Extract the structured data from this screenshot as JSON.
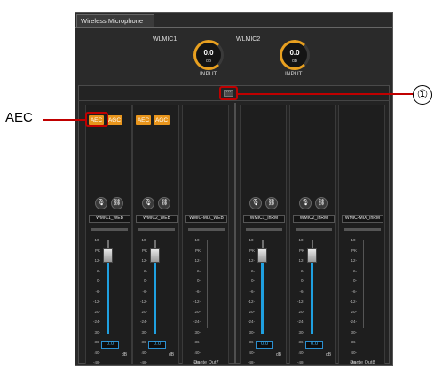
{
  "panel": {
    "tab_label": "Wireless Microphone"
  },
  "inputs": [
    {
      "title": "WLMIC1",
      "value": "0.0",
      "unit": "dB",
      "label": "INPUT"
    },
    {
      "title": "WLMIC2",
      "value": "0.0",
      "unit": "dB",
      "label": "INPUT"
    }
  ],
  "mixer": {
    "more_button": "···"
  },
  "scale_labels": [
    "10-",
    "PK",
    "12-",
    "6-",
    "0-",
    "-6-",
    "-12-",
    "20-",
    "-24-",
    "30-",
    "-36-",
    "40-",
    "-48-"
  ],
  "channels": [
    {
      "name": "WMIC1_WEB",
      "aec": "AEC",
      "agc": "AGC",
      "has_processing": true,
      "has_fader": true,
      "value": "0.0",
      "unit": "dB",
      "output_label": ""
    },
    {
      "name": "WMIC2_WEB",
      "aec": "AEC",
      "agc": "AGC",
      "has_processing": true,
      "has_fader": true,
      "value": "0.0",
      "unit": "dB",
      "output_label": ""
    },
    {
      "name": "WMIC-MIX_WEB",
      "has_processing": false,
      "has_fader": false,
      "output_label": "Dante Out7"
    },
    {
      "name": "WMIC1_InRM",
      "has_processing": false,
      "has_fader": true,
      "value": "0.0",
      "unit": "dB",
      "output_label": ""
    },
    {
      "name": "WMIC2_InRM",
      "has_processing": false,
      "has_fader": true,
      "value": "0.0",
      "unit": "dB",
      "output_label": ""
    },
    {
      "name": "WMIC-MIX_InRM",
      "has_processing": false,
      "has_fader": false,
      "output_label": "Dante Out8"
    }
  ],
  "annotations": {
    "aec_label": "AEC",
    "callout_number": "①",
    "highlight_color": "#c00000"
  },
  "colors": {
    "accent_orange": "#e8951c",
    "fader_blue": "#1fa0e0",
    "panel_bg": "#2a2a2a"
  }
}
